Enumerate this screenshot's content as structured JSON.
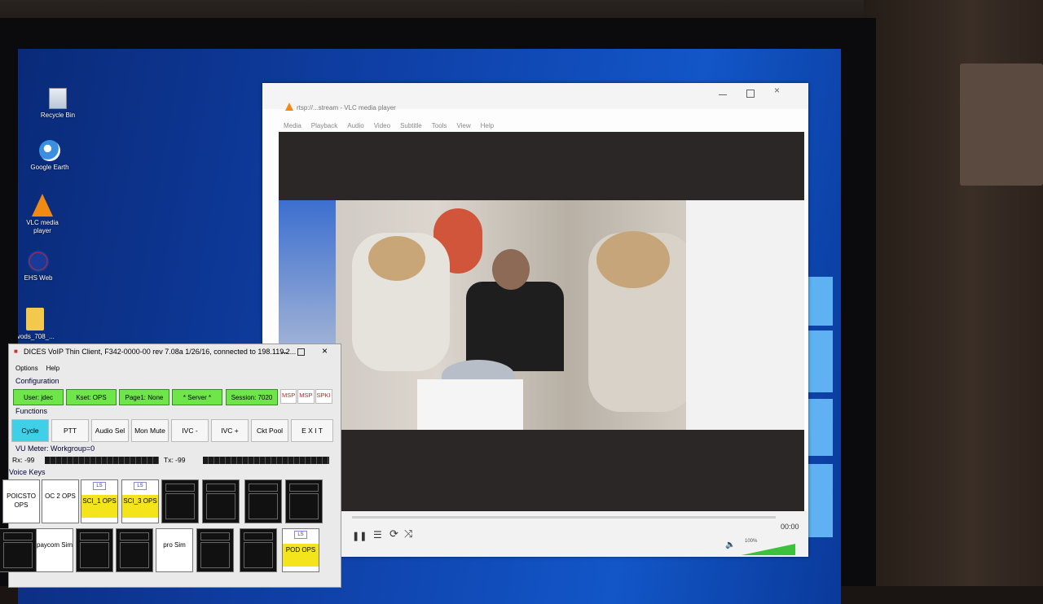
{
  "desktop": {
    "icons": [
      {
        "label": "Recycle Bin",
        "icon": "recycle-bin-icon"
      },
      {
        "label": "Google Earth",
        "icon": "google-earth-icon"
      },
      {
        "label": "VLC media player",
        "icon": "vlc-cone-icon"
      },
      {
        "label": "EHS Web",
        "icon": "nasa-logo-icon"
      },
      {
        "label": "lvods_708_...",
        "icon": "folder-icon"
      }
    ]
  },
  "vlc": {
    "title": "rtsp://...stream - VLC media player",
    "menu": [
      "Media",
      "Playback",
      "Audio",
      "Video",
      "Subtitle",
      "Tools",
      "View",
      "Help"
    ],
    "time": "00:00",
    "volume": "100%",
    "volume_level": 1.0
  },
  "dices": {
    "title": "DICES VoIP Thin Client, F342-0000-00 rev 7.08a 1/26/16, connected to 198.119.2...",
    "menu": [
      "Options",
      "Help"
    ],
    "configuration_label": "Configuration",
    "config_buttons": [
      "User: jdec",
      "Kset: OPS",
      "Page1: None",
      "* Server *",
      "Session: 7020"
    ],
    "status_tags": [
      "MSP",
      "MSP",
      "SPKI"
    ],
    "functions_label": "Functions",
    "function_buttons": [
      "Cycle",
      "PTT",
      "Audio Sel",
      "Mon Mute",
      "IVC -",
      "IVC +",
      "Ckt Pool",
      "E X I T"
    ],
    "vu_label": "VU Meter: Workgroup=0",
    "rx": "Rx: -99",
    "tx": "Tx: -99",
    "voice_keys_label": "Voice Keys",
    "voice_keys_row1": [
      "POICSTO OPS",
      "OC 2 OPS",
      "SCI_1 OPS",
      "SCI_3 OPS"
    ],
    "voice_keys_row2": [
      "paycom Sim",
      "pro Sim",
      "POD OPS"
    ],
    "ls_tag": "LS"
  },
  "colors": {
    "config_green": "#6ee64a",
    "cycle_cyan": "#3fd0e8",
    "key_yellow": "#f4e41c"
  }
}
